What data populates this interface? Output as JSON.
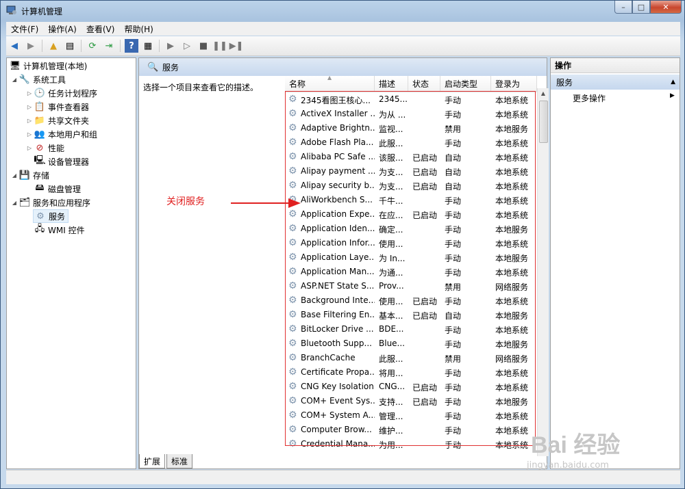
{
  "window": {
    "title": "计算机管理",
    "min": "–",
    "max": "□",
    "close": "✕"
  },
  "menu": [
    "文件(F)",
    "操作(A)",
    "查看(V)",
    "帮助(H)"
  ],
  "tree": [
    {
      "label": "计算机管理(本地)",
      "indent": 0,
      "tri": "",
      "icon": "🖥"
    },
    {
      "label": "系统工具",
      "indent": 1,
      "tri": "◢",
      "icon": "🔧"
    },
    {
      "label": "任务计划程序",
      "indent": 2,
      "tri": "▷",
      "icon": "🕒"
    },
    {
      "label": "事件查看器",
      "indent": 2,
      "tri": "▷",
      "icon": "📋"
    },
    {
      "label": "共享文件夹",
      "indent": 2,
      "tri": "▷",
      "icon": "📁"
    },
    {
      "label": "本地用户和组",
      "indent": 2,
      "tri": "▷",
      "icon": "👥"
    },
    {
      "label": "性能",
      "indent": 2,
      "tri": "▷",
      "icon": "⊘"
    },
    {
      "label": "设备管理器",
      "indent": 2,
      "tri": "",
      "icon": "🖳"
    },
    {
      "label": "存储",
      "indent": 1,
      "tri": "◢",
      "icon": "💾"
    },
    {
      "label": "磁盘管理",
      "indent": 2,
      "tri": "",
      "icon": "🖴"
    },
    {
      "label": "服务和应用程序",
      "indent": 1,
      "tri": "◢",
      "icon": "🗂"
    },
    {
      "label": "服务",
      "indent": 2,
      "tri": "",
      "icon": "⚙"
    },
    {
      "label": "WMI 控件",
      "indent": 2,
      "tri": "",
      "icon": "🖧"
    }
  ],
  "services_header": "服务",
  "description_text": "选择一个项目来查看它的描述。",
  "columns": [
    "名称",
    "描述",
    "状态",
    "启动类型",
    "登录为"
  ],
  "services": [
    [
      "2345看图王核心...",
      "2345...",
      "",
      "手动",
      "本地系统"
    ],
    [
      "ActiveX Installer ...",
      "为从 ...",
      "",
      "手动",
      "本地系统"
    ],
    [
      "Adaptive Brightn...",
      "监视...",
      "",
      "禁用",
      "本地服务"
    ],
    [
      "Adobe Flash Pla...",
      "此服...",
      "",
      "手动",
      "本地系统"
    ],
    [
      "Alibaba PC Safe ...",
      "该服...",
      "已启动",
      "自动",
      "本地系统"
    ],
    [
      "Alipay payment ...",
      "为支...",
      "已启动",
      "自动",
      "本地系统"
    ],
    [
      "Alipay security b...",
      "为支...",
      "已启动",
      "自动",
      "本地系统"
    ],
    [
      "AliWorkbench S...",
      "千牛...",
      "",
      "手动",
      "本地系统"
    ],
    [
      "Application Expe...",
      "在应...",
      "已启动",
      "手动",
      "本地系统"
    ],
    [
      "Application Iden...",
      "确定...",
      "",
      "手动",
      "本地服务"
    ],
    [
      "Application Infor...",
      "使用...",
      "",
      "手动",
      "本地系统"
    ],
    [
      "Application Laye...",
      "为 In...",
      "",
      "手动",
      "本地服务"
    ],
    [
      "Application Man...",
      "为通...",
      "",
      "手动",
      "本地系统"
    ],
    [
      "ASP.NET State S...",
      "Prov...",
      "",
      "禁用",
      "网络服务"
    ],
    [
      "Background Inte...",
      "使用...",
      "已启动",
      "手动",
      "本地系统"
    ],
    [
      "Base Filtering En...",
      "基本...",
      "已启动",
      "自动",
      "本地服务"
    ],
    [
      "BitLocker Drive ...",
      "BDE...",
      "",
      "手动",
      "本地系统"
    ],
    [
      "Bluetooth Supp...",
      "Blue...",
      "",
      "手动",
      "本地服务"
    ],
    [
      "BranchCache",
      "此服...",
      "",
      "禁用",
      "网络服务"
    ],
    [
      "Certificate Propa...",
      "将用...",
      "",
      "手动",
      "本地系统"
    ],
    [
      "CNG Key Isolation",
      "CNG...",
      "已启动",
      "手动",
      "本地系统"
    ],
    [
      "COM+ Event Sys...",
      "支持...",
      "已启动",
      "手动",
      "本地服务"
    ],
    [
      "COM+ System A...",
      "管理...",
      "",
      "手动",
      "本地系统"
    ],
    [
      "Computer Brow...",
      "维护...",
      "",
      "手动",
      "本地系统"
    ],
    [
      "Credential Mana...",
      "为用...",
      "",
      "手动",
      "本地系统"
    ]
  ],
  "annotation": "关闭服务",
  "tabs": [
    "扩展",
    "标准"
  ],
  "actions": {
    "header": "操作",
    "section": "服务",
    "more": "更多操作"
  },
  "watermark": {
    "main": "Bai 经验",
    "sub": "jingyan.baidu.com"
  }
}
